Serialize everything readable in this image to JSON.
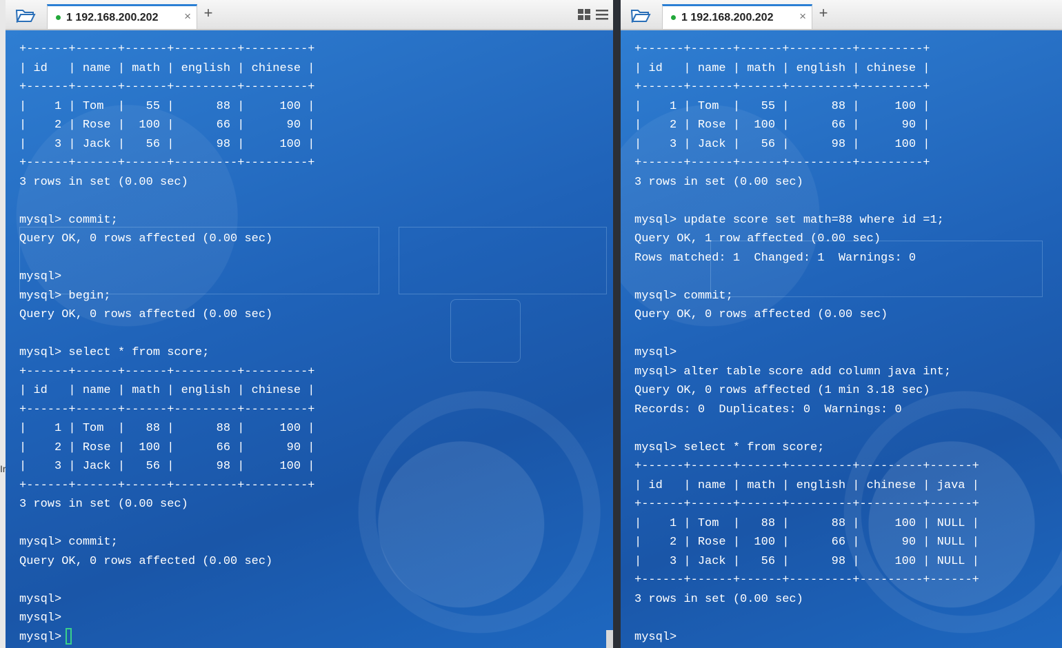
{
  "left_pane": {
    "tab": {
      "index": "1",
      "title": "192.168.200.202",
      "status_color": "#22a83a"
    },
    "lines": [
      "+------+------+------+---------+---------+",
      "| id   | name | math | english | chinese |",
      "+------+------+------+---------+---------+",
      "|    1 | Tom  |   55 |      88 |     100 |",
      "|    2 | Rose |  100 |      66 |      90 |",
      "|    3 | Jack |   56 |      98 |     100 |",
      "+------+------+------+---------+---------+",
      "3 rows in set (0.00 sec)",
      "",
      "mysql> commit;",
      "Query OK, 0 rows affected (0.00 sec)",
      "",
      "mysql>",
      "mysql> begin;",
      "Query OK, 0 rows affected (0.00 sec)",
      "",
      "mysql> select * from score;",
      "+------+------+------+---------+---------+",
      "| id   | name | math | english | chinese |",
      "+------+------+------+---------+---------+",
      "|    1 | Tom  |   88 |      88 |     100 |",
      "|    2 | Rose |  100 |      66 |      90 |",
      "|    3 | Jack |   56 |      98 |     100 |",
      "+------+------+------+---------+---------+",
      "3 rows in set (0.00 sec)",
      "",
      "mysql> commit;",
      "Query OK, 0 rows affected (0.00 sec)",
      "",
      "mysql>",
      "mysql>"
    ],
    "prompt": "mysql>"
  },
  "right_pane": {
    "tab": {
      "index": "1",
      "title": "192.168.200.202",
      "status_color": "#22a83a"
    },
    "lines": [
      "+------+------+------+---------+---------+",
      "| id   | name | math | english | chinese |",
      "+------+------+------+---------+---------+",
      "|    1 | Tom  |   55 |      88 |     100 |",
      "|    2 | Rose |  100 |      66 |      90 |",
      "|    3 | Jack |   56 |      98 |     100 |",
      "+------+------+------+---------+---------+",
      "3 rows in set (0.00 sec)",
      "",
      "mysql> update score set math=88 where id =1;",
      "Query OK, 1 row affected (0.00 sec)",
      "Rows matched: 1  Changed: 1  Warnings: 0",
      "",
      "mysql> commit;",
      "Query OK, 0 rows affected (0.00 sec)",
      "",
      "mysql>",
      "mysql> alter table score add column java int;",
      "Query OK, 0 rows affected (1 min 3.18 sec)",
      "Records: 0  Duplicates: 0  Warnings: 0",
      "",
      "mysql> select * from score;",
      "+------+------+------+---------+---------+------+",
      "| id   | name | math | english | chinese | java |",
      "+------+------+------+---------+---------+------+",
      "|    1 | Tom  |   88 |      88 |     100 | NULL |",
      "|    2 | Rose |  100 |      66 |      90 | NULL |",
      "|    3 | Jack |   56 |      98 |     100 | NULL |",
      "+------+------+------+---------+---------+------+",
      "3 rows in set (0.00 sec)",
      "",
      "mysql>"
    ]
  },
  "icons": {
    "folder": "folder-open-icon",
    "add_tab": "plus-icon",
    "close_tab": "close-icon",
    "grid_layout": "grid-layout-icon",
    "menu": "menu-icon"
  },
  "labels": {
    "plus": "+",
    "close": "×"
  },
  "colors": {
    "terminal_bg": "#1f62b8",
    "terminal_text": "#ffffff",
    "tab_accent": "#2a7fd4",
    "cursor": "#3ad08a"
  }
}
